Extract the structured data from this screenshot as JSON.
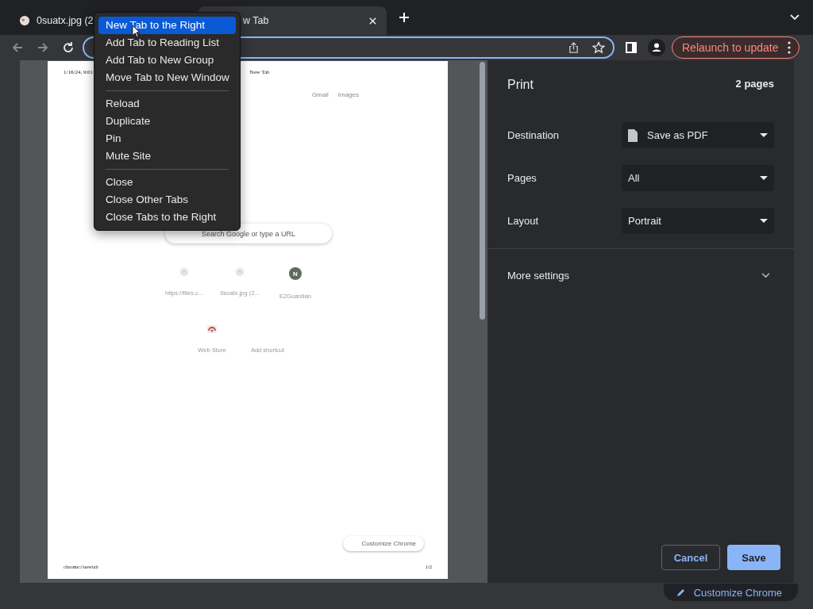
{
  "tabs": [
    {
      "title": "0suatx.jpg (2",
      "selected": false
    },
    {
      "title": "w Tab",
      "selected": true
    }
  ],
  "toolbar": {
    "relaunch": "Relaunch to update"
  },
  "context_menu": {
    "groups": [
      [
        {
          "label": "New Tab to the Right",
          "selected": true
        },
        {
          "label": "Add Tab to Reading List",
          "selected": false
        },
        {
          "label": "Add Tab to New Group",
          "selected": false
        },
        {
          "label": "Move Tab to New Window",
          "selected": false
        }
      ],
      [
        {
          "label": "Reload",
          "selected": false
        },
        {
          "label": "Duplicate",
          "selected": false
        },
        {
          "label": "Pin",
          "selected": false
        },
        {
          "label": "Mute Site",
          "selected": false
        }
      ],
      [
        {
          "label": "Close",
          "selected": false
        },
        {
          "label": "Close Other Tabs",
          "selected": false
        },
        {
          "label": "Close Tabs to the Right",
          "selected": false
        }
      ]
    ]
  },
  "preview": {
    "date": "1/16/24, 9:01",
    "title": "New Tab",
    "links": [
      "Gmail",
      "Images"
    ],
    "search_placeholder": "Search Google or type a URL",
    "shortcuts": [
      {
        "label": "https://files.c...",
        "kind": "favicon"
      },
      {
        "label": "0suatx.jpg (2...",
        "kind": "favicon"
      },
      {
        "label": "E2Guardian",
        "kind": "letter",
        "letter": "N"
      },
      {
        "label": "Web Store",
        "kind": "store"
      },
      {
        "label": "Add shortcut",
        "kind": "add"
      }
    ],
    "customize": "Customize Chrome",
    "url": "chrome://newtab",
    "page_number": "1/2"
  },
  "print": {
    "title": "Print",
    "page_count": "2 pages",
    "settings": [
      {
        "label": "Destination",
        "value": "Save as PDF",
        "kind": "file"
      },
      {
        "label": "Pages",
        "value": "All",
        "kind": "plain"
      },
      {
        "label": "Layout",
        "value": "Portrait",
        "kind": "plain"
      }
    ],
    "more_settings": "More settings",
    "cancel": "Cancel",
    "save": "Save"
  },
  "customize_button": "Customize Chrome"
}
